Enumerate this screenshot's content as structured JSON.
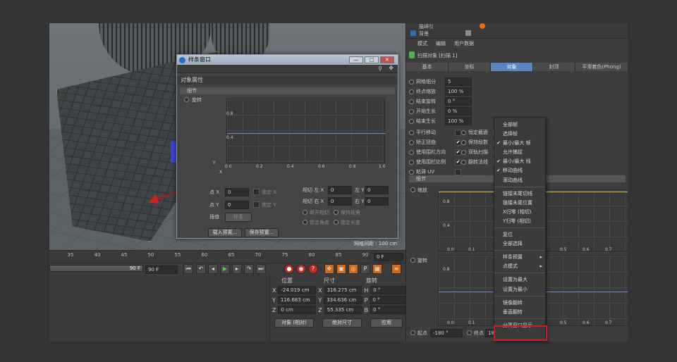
{
  "timeline": {
    "ticks": [
      "35",
      "40",
      "45",
      "50",
      "55",
      "60",
      "65",
      "70",
      "75",
      "80",
      "85",
      "90"
    ],
    "frame_field": "0 F",
    "end_frame": "90 F",
    "end_frame2": "90 F"
  },
  "coords": {
    "headers": [
      "位置",
      "尺寸",
      "旋转"
    ],
    "rows": [
      {
        "axis": "X",
        "pos": "-24.019 cm",
        "size": "316.275 cm",
        "rot_axis": "H",
        "rot": "0 °"
      },
      {
        "axis": "Y",
        "pos": "116.683 cm",
        "size": "334.636 cm",
        "rot_axis": "P",
        "rot": "0 °"
      },
      {
        "axis": "Z",
        "pos": "0 cm",
        "size": "55.335 cm",
        "rot_axis": "B",
        "rot": "0 °"
      }
    ],
    "mode1": "对象 (相对)",
    "mode2": "绝对尺寸",
    "apply": "应用"
  },
  "dialog": {
    "title": "样条窗口",
    "section": "对象属性",
    "group": "细节",
    "param": "旋转",
    "graph": {
      "y_labels": [
        "0.8",
        "0.4"
      ],
      "x_labels": [
        "0.0",
        "0.2",
        "0.4",
        "0.6",
        "0.8",
        "1.0"
      ],
      "y_axis": "Y",
      "x_axis": "X"
    },
    "pointx_label": "点 X",
    "pointx": "0",
    "lockx": "锁定 X",
    "pointy_label": "点 Y",
    "pointy": "0",
    "locky": "锁定 Y",
    "interp_label": "插值",
    "interp": "样条",
    "tan_lx": "相切 左 X",
    "tan_lx_val": "0",
    "tan_ly": "左 Y",
    "tan_ly_val": "0",
    "tan_rx": "相切 右 X",
    "tan_rx_val": "0",
    "tan_ry": "右 Y",
    "tan_ry_val": "0",
    "break_tan": "断开相切",
    "keep_visual": "保持视角",
    "lock_angle": "锁定角度",
    "lock_len": "锁定长度",
    "load_preset": "载入预置...",
    "save_preset": "保存预置...",
    "grid_spacing": "网格间距 : 100 cm"
  },
  "attr": {
    "objlist": [
      {
        "name": "猫缔引"
      },
      {
        "name": "背景"
      }
    ],
    "menu": [
      "模式",
      "编辑",
      "用户数据"
    ],
    "object_title": "扫描对象 [扫描 1]",
    "tabs": [
      "基本",
      "坐标",
      "对象",
      "封顶",
      "平滑着色(Phong)"
    ],
    "active_tab": "对象",
    "fields": [
      {
        "label": "网格细分",
        "value": "5"
      },
      {
        "label": "终点缩放",
        "value": "100 %"
      },
      {
        "label": "结束旋转",
        "value": "0 °"
      },
      {
        "label": "开始生长",
        "value": "0 %"
      },
      {
        "label": "结束生长",
        "value": "100 %"
      }
    ],
    "checks_left": [
      {
        "label": "平行移动",
        "checked": false
      },
      {
        "label": "矫正扭曲",
        "checked": true
      },
      {
        "label": "使用围栏方向",
        "checked": true
      },
      {
        "label": "使用围栏比例",
        "checked": true
      },
      {
        "label": "粘滞 UV",
        "checked": false
      }
    ],
    "checks_right": [
      {
        "label": "恒定截面",
        "checked": true
      },
      {
        "label": "保持段数",
        "checked": true
      },
      {
        "label": "双轨扫描",
        "checked": true
      },
      {
        "label": "翻转法线",
        "checked": false
      }
    ],
    "detail_group": "细节",
    "graph1_label": "缩放",
    "graph2_label": "旋转",
    "graph_y": "0.8",
    "graph_y2": "0.4",
    "graph_x": [
      "0.0",
      "0.1",
      "0.2",
      "0.3",
      "0.4",
      "0.5",
      "0.6",
      "0.7"
    ],
    "start_label": "起点",
    "start_value": "-180 °",
    "end_label": "终点",
    "end_value": "180"
  },
  "context_menu": [
    {
      "label": "全部帧"
    },
    {
      "label": "选择帧"
    },
    {
      "label": "最小/最大 帧",
      "check": true
    },
    {
      "label": "允许捕捉"
    },
    {
      "label": "最小/最大 线",
      "check": true
    },
    {
      "label": "移动曲线",
      "check": true
    },
    {
      "label": "滚动曲线"
    },
    {
      "sep": true
    },
    {
      "label": "链接末尾切线"
    },
    {
      "label": "链接末尾位置"
    },
    {
      "label": "X归零 (相切)"
    },
    {
      "label": "Y归零 (相切)"
    },
    {
      "sep": true
    },
    {
      "label": "复位"
    },
    {
      "label": "全部选择"
    },
    {
      "sep": true
    },
    {
      "label": "样条预置",
      "sub": true
    },
    {
      "label": "点模式",
      "sub": true
    },
    {
      "sep": true
    },
    {
      "label": "设置为最大"
    },
    {
      "label": "设置为最小"
    },
    {
      "sep": true
    },
    {
      "label": "镜像翻转"
    },
    {
      "label": "垂直翻转"
    },
    {
      "sep": true
    },
    {
      "label": "分离窗口显示..."
    }
  ],
  "check_mark": "✔",
  "submenu_arrow": "▸"
}
